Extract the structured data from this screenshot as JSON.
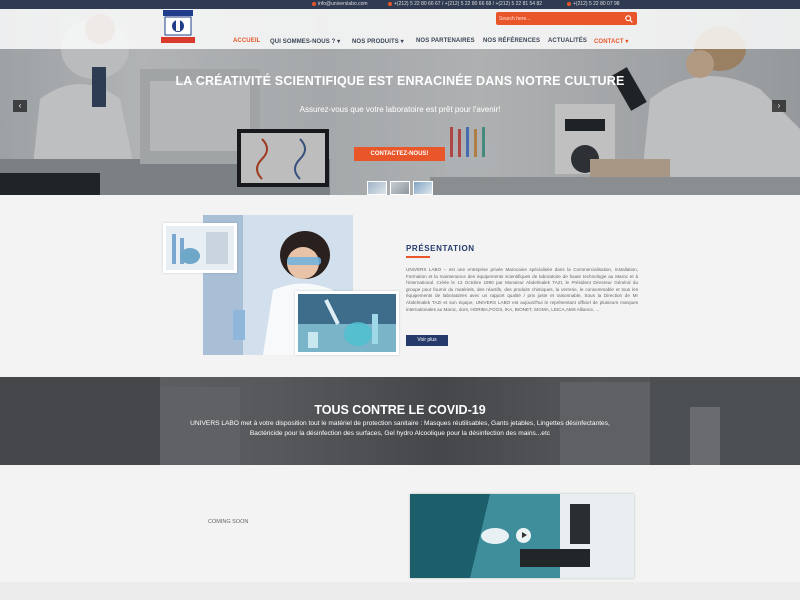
{
  "topbar": {
    "email": "info@universlabo.com",
    "phone1": "+(212) 5 22 80 66 67 / +(212) 5 22 80 66 68 / +(212) 5 22 81 54 82",
    "phone2": "+(212) 5 22 80 07 98"
  },
  "header": {
    "logo_text": "UNIVERS LABO",
    "search_placeholder": "Search here..."
  },
  "nav": {
    "items": [
      {
        "label": "ACCUEIL",
        "active": true
      },
      {
        "label": "QUI SOMMES-NOUS ?",
        "has_dropdown": true
      },
      {
        "label": "NOS PRODUITS",
        "has_dropdown": true
      },
      {
        "label": "NOS PARTENAIRES"
      },
      {
        "label": "NOS RÉFÉRENCES"
      },
      {
        "label": "ACTUALITÉS"
      },
      {
        "label": "CONTACT",
        "has_dropdown": true
      }
    ]
  },
  "hero": {
    "title": "LA CRÉATIVITÉ SCIENTIFIQUE EST ENRACINÉE DANS NOTRE CULTURE",
    "subtitle": "Assurez-vous que votre laboratoire est prêt pour l'avenir!",
    "button": "CONTACTEZ-NOUS!",
    "prev": "‹",
    "next": "›"
  },
  "presentation": {
    "title": "PRÉSENTATION",
    "text": "UNIVERS LABO – est une entreprise privée Marocaine spécialisée dans la Commercialisation, Installation, Formation et la maintenance des équipements scientifiques de laboratoire de haute technologie au Maroc et à l'international. Créée le 13 Octobre 1990 par Monsieur Abdelmalek TAZI, le Président Directeur Général du groupe pour fournir du matériels, des réactifs, des produits chimiques, la verrerie, le consommable et tous les équipements de laboratoires avec un rapport qualité / prix juste et raisonnable, Sous la Direction de Mr Abdelmalek TAZI et son équipe, UNIVERS LABO est aujourd'hui le représentant officiel de plusieurs marques internationales au Maroc, dont, HORIBA,FOGS, IKA, BIONET, SIGMA, LEICA,AMS Alliance, ...",
    "button": "Voir plus"
  },
  "covid": {
    "title": "TOUS CONTRE LE COVID-19",
    "text": "UNIVERS LABO met à votre disposition tout le matériel de protection sanitaire : Masques réutilisables, Gants jetables, Lingettes désinfectantes, Bactéricide pour la désinfection des surfaces, Gel hydro Alcoolique pour la désinfection des mains...etc"
  },
  "bottom": {
    "coming_soon": "COMING SOON"
  },
  "colors": {
    "accent": "#e8562a",
    "navy": "#253a6a",
    "topbar": "#2f3b52"
  }
}
